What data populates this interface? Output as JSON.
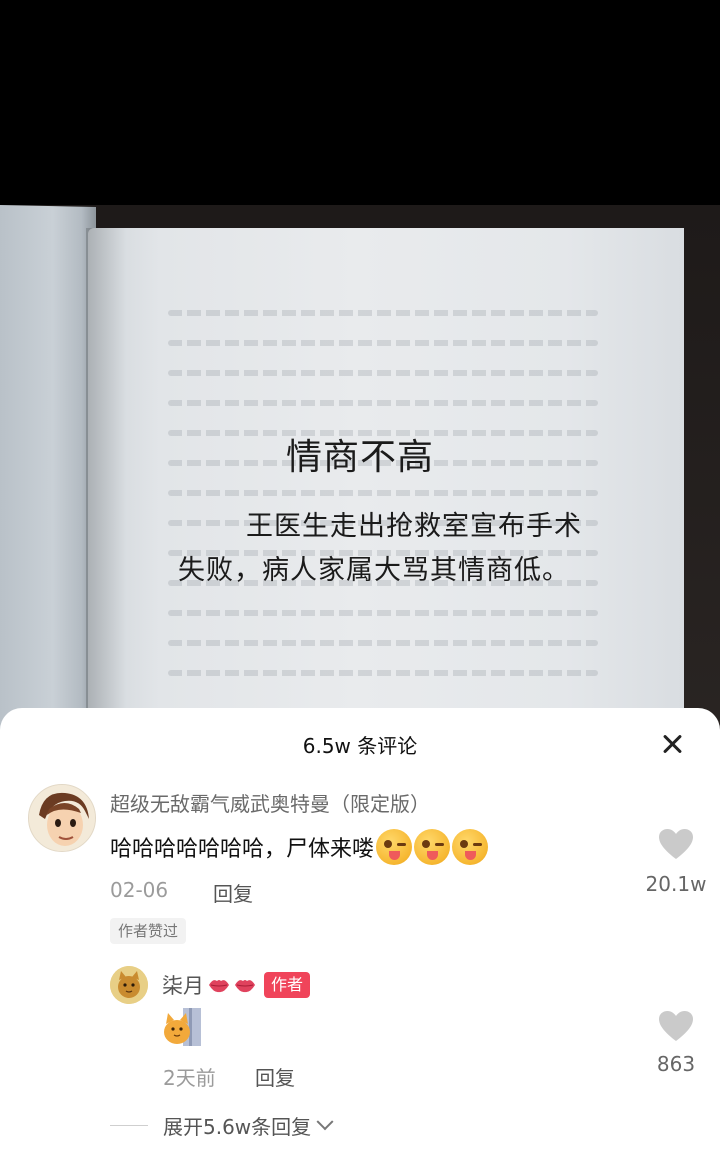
{
  "photo": {
    "book_title": "情商不高",
    "book_text": "王医生走出抢救室宣布手术失败，病人家属大骂其情商低。"
  },
  "comments_panel": {
    "header": "6.5w 条评论",
    "close_icon": "close-icon",
    "comment": {
      "username": "超级无敌霸气威武奥特曼（限定版）",
      "text": "哈哈哈哈哈哈哈，尸体来喽",
      "emoji": "tongue-wink-emoji",
      "emoji_count": 3,
      "date": "02-06",
      "reply_label": "回复",
      "author_liked": "作者赞过",
      "like_count": "20.1w"
    },
    "reply": {
      "username": "柒月",
      "author_badge": "作者",
      "sticker": "cat-sticker",
      "date": "2天前",
      "reply_label": "回复",
      "like_count": "863"
    },
    "expand_label": "展开5.6w条回复"
  },
  "colors": {
    "author_badge": "#f0445a",
    "panel_bg": "#ffffff",
    "like_icon": "#c8c8c8"
  }
}
